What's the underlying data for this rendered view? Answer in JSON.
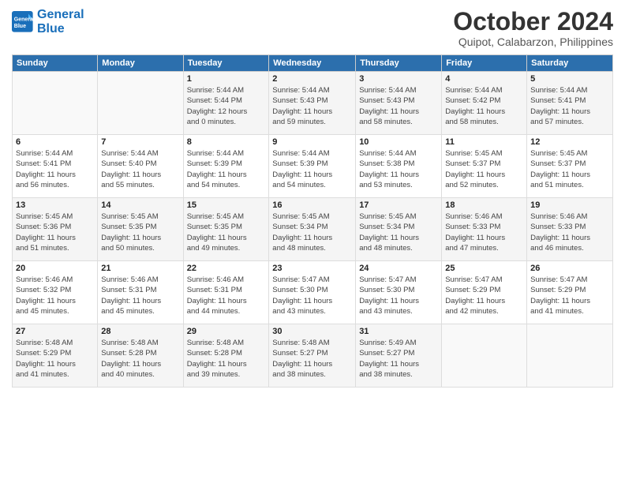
{
  "logo": {
    "line1": "General",
    "line2": "Blue"
  },
  "title": "October 2024",
  "subtitle": "Quipot, Calabarzon, Philippines",
  "weekdays": [
    "Sunday",
    "Monday",
    "Tuesday",
    "Wednesday",
    "Thursday",
    "Friday",
    "Saturday"
  ],
  "weeks": [
    [
      {
        "day": "",
        "info": ""
      },
      {
        "day": "",
        "info": ""
      },
      {
        "day": "1",
        "info": "Sunrise: 5:44 AM\nSunset: 5:44 PM\nDaylight: 12 hours\nand 0 minutes."
      },
      {
        "day": "2",
        "info": "Sunrise: 5:44 AM\nSunset: 5:43 PM\nDaylight: 11 hours\nand 59 minutes."
      },
      {
        "day": "3",
        "info": "Sunrise: 5:44 AM\nSunset: 5:43 PM\nDaylight: 11 hours\nand 58 minutes."
      },
      {
        "day": "4",
        "info": "Sunrise: 5:44 AM\nSunset: 5:42 PM\nDaylight: 11 hours\nand 58 minutes."
      },
      {
        "day": "5",
        "info": "Sunrise: 5:44 AM\nSunset: 5:41 PM\nDaylight: 11 hours\nand 57 minutes."
      }
    ],
    [
      {
        "day": "6",
        "info": "Sunrise: 5:44 AM\nSunset: 5:41 PM\nDaylight: 11 hours\nand 56 minutes."
      },
      {
        "day": "7",
        "info": "Sunrise: 5:44 AM\nSunset: 5:40 PM\nDaylight: 11 hours\nand 55 minutes."
      },
      {
        "day": "8",
        "info": "Sunrise: 5:44 AM\nSunset: 5:39 PM\nDaylight: 11 hours\nand 54 minutes."
      },
      {
        "day": "9",
        "info": "Sunrise: 5:44 AM\nSunset: 5:39 PM\nDaylight: 11 hours\nand 54 minutes."
      },
      {
        "day": "10",
        "info": "Sunrise: 5:44 AM\nSunset: 5:38 PM\nDaylight: 11 hours\nand 53 minutes."
      },
      {
        "day": "11",
        "info": "Sunrise: 5:45 AM\nSunset: 5:37 PM\nDaylight: 11 hours\nand 52 minutes."
      },
      {
        "day": "12",
        "info": "Sunrise: 5:45 AM\nSunset: 5:37 PM\nDaylight: 11 hours\nand 51 minutes."
      }
    ],
    [
      {
        "day": "13",
        "info": "Sunrise: 5:45 AM\nSunset: 5:36 PM\nDaylight: 11 hours\nand 51 minutes."
      },
      {
        "day": "14",
        "info": "Sunrise: 5:45 AM\nSunset: 5:35 PM\nDaylight: 11 hours\nand 50 minutes."
      },
      {
        "day": "15",
        "info": "Sunrise: 5:45 AM\nSunset: 5:35 PM\nDaylight: 11 hours\nand 49 minutes."
      },
      {
        "day": "16",
        "info": "Sunrise: 5:45 AM\nSunset: 5:34 PM\nDaylight: 11 hours\nand 48 minutes."
      },
      {
        "day": "17",
        "info": "Sunrise: 5:45 AM\nSunset: 5:34 PM\nDaylight: 11 hours\nand 48 minutes."
      },
      {
        "day": "18",
        "info": "Sunrise: 5:46 AM\nSunset: 5:33 PM\nDaylight: 11 hours\nand 47 minutes."
      },
      {
        "day": "19",
        "info": "Sunrise: 5:46 AM\nSunset: 5:33 PM\nDaylight: 11 hours\nand 46 minutes."
      }
    ],
    [
      {
        "day": "20",
        "info": "Sunrise: 5:46 AM\nSunset: 5:32 PM\nDaylight: 11 hours\nand 45 minutes."
      },
      {
        "day": "21",
        "info": "Sunrise: 5:46 AM\nSunset: 5:31 PM\nDaylight: 11 hours\nand 45 minutes."
      },
      {
        "day": "22",
        "info": "Sunrise: 5:46 AM\nSunset: 5:31 PM\nDaylight: 11 hours\nand 44 minutes."
      },
      {
        "day": "23",
        "info": "Sunrise: 5:47 AM\nSunset: 5:30 PM\nDaylight: 11 hours\nand 43 minutes."
      },
      {
        "day": "24",
        "info": "Sunrise: 5:47 AM\nSunset: 5:30 PM\nDaylight: 11 hours\nand 43 minutes."
      },
      {
        "day": "25",
        "info": "Sunrise: 5:47 AM\nSunset: 5:29 PM\nDaylight: 11 hours\nand 42 minutes."
      },
      {
        "day": "26",
        "info": "Sunrise: 5:47 AM\nSunset: 5:29 PM\nDaylight: 11 hours\nand 41 minutes."
      }
    ],
    [
      {
        "day": "27",
        "info": "Sunrise: 5:48 AM\nSunset: 5:29 PM\nDaylight: 11 hours\nand 41 minutes."
      },
      {
        "day": "28",
        "info": "Sunrise: 5:48 AM\nSunset: 5:28 PM\nDaylight: 11 hours\nand 40 minutes."
      },
      {
        "day": "29",
        "info": "Sunrise: 5:48 AM\nSunset: 5:28 PM\nDaylight: 11 hours\nand 39 minutes."
      },
      {
        "day": "30",
        "info": "Sunrise: 5:48 AM\nSunset: 5:27 PM\nDaylight: 11 hours\nand 38 minutes."
      },
      {
        "day": "31",
        "info": "Sunrise: 5:49 AM\nSunset: 5:27 PM\nDaylight: 11 hours\nand 38 minutes."
      },
      {
        "day": "",
        "info": ""
      },
      {
        "day": "",
        "info": ""
      }
    ]
  ]
}
